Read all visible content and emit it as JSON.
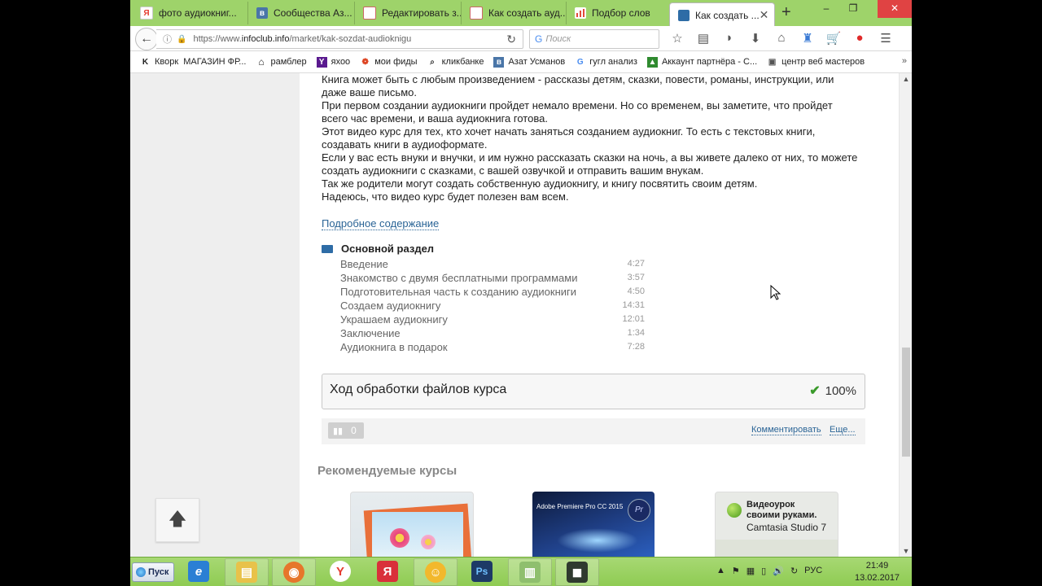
{
  "browser": {
    "tabs": [
      {
        "label": "фото аудиокниг...",
        "icon": "yandex-icon",
        "color": "#ffffff"
      },
      {
        "label": "Сообщества Аз...",
        "icon": "vk-icon",
        "color": "#4a76a8"
      },
      {
        "label": "Редактировать з...",
        "icon": "page-icon",
        "color": "#cc6666"
      },
      {
        "label": "Как создать ауд...",
        "icon": "page-icon",
        "color": "#cc6666"
      },
      {
        "label": "Подбор слов",
        "icon": "wordstat-icon",
        "color": "#e24a3b"
      },
      {
        "label": "Как создать ...",
        "icon": "infoclub-icon",
        "color": "#2e6ca6",
        "active": true
      }
    ],
    "new_tab": "+",
    "window_controls": {
      "minimize": "–",
      "maximize": "❐",
      "close": "✕"
    },
    "url": {
      "prefix": "https://www.",
      "domain": "infoclub.info",
      "path": "/market/kak-sozdat-audioknigu"
    },
    "search_placeholder": "Поиск",
    "bookmarks": [
      {
        "label": "Кворк",
        "icon": "kwork-icon"
      },
      {
        "label": "МАГАЗИН ФР...",
        "icon": "folder-icon"
      },
      {
        "label": "рамблер",
        "icon": "home-icon"
      },
      {
        "label": "яхоо",
        "icon": "yahoo-icon"
      },
      {
        "label": "мои фиды",
        "icon": "feed-icon"
      },
      {
        "label": "кликбанке",
        "icon": "search-icon"
      },
      {
        "label": "Азат Усманов",
        "icon": "vk-icon"
      },
      {
        "label": "гугл анализ",
        "icon": "google-icon"
      },
      {
        "label": "Аккаунт партнёра - С...",
        "icon": "partner-icon"
      },
      {
        "label": "центр веб мастеров",
        "icon": "webmaster-icon"
      }
    ],
    "bookmarks_more": "»"
  },
  "page": {
    "description": [
      "Книга может быть с любым произведением - рассказы детям, сказки, повести, романы, инструкции, или даже ваше письмо.",
      "При первом создании аудиокниги пройдет немало времени. Но со временем, вы заметите, что пройдет всего час времени, и ваша аудиокнига готова.",
      "Этот видео курс для тех, кто хочет начать заняться созданием аудиокниг. То есть с текстовых книги, создавать книги в аудиоформате.",
      "Если у вас есть внуки и внучки, и им нужно рассказать сказки на ночь, а вы живете далеко от них, то можете создать аудиокниги с сказками, с вашей озвучкой и отправить вашим внукам.",
      "Так же родители могут создать собственную аудиокнигу, и книгу посвятить своим детям.",
      "Надеюсь, что видео курс будет полезен вам всем."
    ],
    "more_link": "Подробное содержание",
    "section_title": "Основной раздел",
    "lessons": [
      {
        "title": "Введение",
        "time": "4:27"
      },
      {
        "title": "Знакомство с двумя бесплатными программами",
        "time": "3:57"
      },
      {
        "title": "Подготовительная часть к созданию аудиокниги",
        "time": "4:50"
      },
      {
        "title": "Создаем аудиокнигу",
        "time": "14:31"
      },
      {
        "title": "Украшаем аудиокнигу",
        "time": "12:01"
      },
      {
        "title": "Заключение",
        "time": "1:34"
      },
      {
        "title": "Аудиокнига в подарок",
        "time": "7:28"
      }
    ],
    "processing": {
      "title": "Ход обработки файлов курса",
      "percent": "100%"
    },
    "views_count": "0",
    "comment_link": "Комментировать",
    "more_actions": "Еще...",
    "recommended_title": "Рекомендуемые курсы",
    "cards": [
      {
        "title": ""
      },
      {
        "title": "Adobe Premiere Pro CC 2015",
        "badge": "Pr"
      },
      {
        "line1": "Видеоурок",
        "line2": "своими руками.",
        "line3": "Camtasia Studio 7"
      }
    ]
  },
  "taskbar": {
    "start_label": "Пуск",
    "apps": [
      {
        "name": "internet-explorer-icon",
        "glyph": "e",
        "color": "#2a7fd4"
      },
      {
        "name": "explorer-folder-icon",
        "glyph": "▤",
        "color": "#e8c24a"
      },
      {
        "name": "firefox-icon",
        "glyph": "◉",
        "color": "#e6762b"
      },
      {
        "name": "yandex-browser-icon",
        "glyph": "Y",
        "color": "#e53b2f"
      },
      {
        "name": "yandex-icon",
        "glyph": "Я",
        "color": "#d9303a"
      },
      {
        "name": "messenger-icon",
        "glyph": "☺",
        "color": "#f2b82c"
      },
      {
        "name": "photoshop-icon",
        "glyph": "Ps",
        "color": "#1d3a66"
      },
      {
        "name": "notes-icon",
        "glyph": "▥",
        "color": "#8fbf6e"
      },
      {
        "name": "camtasia-icon",
        "glyph": "◼",
        "color": "#2f3a2f"
      }
    ],
    "lang": "РУС",
    "time": "21:49",
    "date": "13.02.2017"
  }
}
